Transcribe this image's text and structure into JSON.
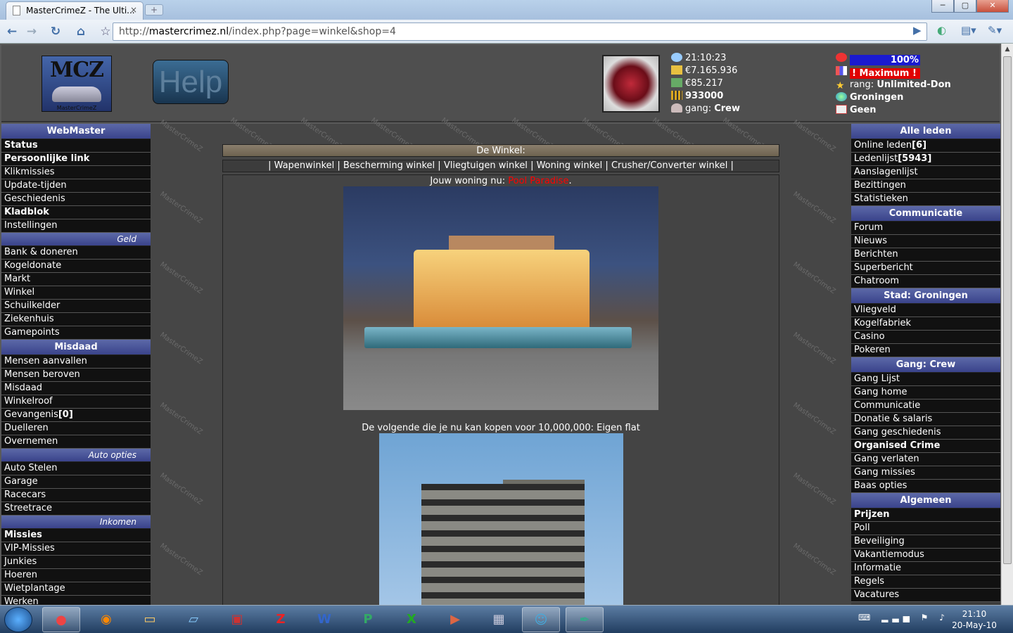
{
  "browser": {
    "tab_title": "MasterCrimeZ - The Ulti...",
    "tab_close": "×",
    "new_tab": "+",
    "url_prefix": "http://",
    "url_domain": "mastercrimez.nl",
    "url_path": "/index.php?page=winkel&shop=4",
    "win_min": "─",
    "win_max": "▢",
    "win_close": "✕"
  },
  "header": {
    "logo_text": "MCZ",
    "logo_sub": "MasterCrimeZ",
    "help_label": "Help",
    "avatar_text": "W",
    "time": "21:10:23",
    "cash": "€7.165.936",
    "bank": "€85.217",
    "bullets": "933000",
    "gang_label": "gang: ",
    "gang_value": "Crew",
    "health": "100%",
    "power": "! Maximum !",
    "rank_label": "rang: ",
    "rank_value": "Unlimited-Don",
    "city": "Groningen",
    "messages": "Geen"
  },
  "left_menu": {
    "webmaster": "WebMaster",
    "status": "Status",
    "persoonlijke": "Persoonlijke link",
    "klikmissies": "Klikmissies",
    "update": "Update-tijden",
    "geschiedenis": "Geschiedenis",
    "kladblok": "Kladblok",
    "instellingen": "Instellingen",
    "geld": "Geld",
    "bank": "Bank & doneren",
    "kogeldonate": "Kogeldonate",
    "markt": "Markt",
    "winkel": "Winkel",
    "schuilkelder": "Schuilkelder",
    "ziekenhuis": "Ziekenhuis",
    "gamepoints": "Gamepoints",
    "misdaad_h": "Misdaad",
    "aanvallen": "Mensen aanvallen",
    "beroven": "Mensen beroven",
    "misdaad": "Misdaad",
    "winkelroof": "Winkelroof",
    "gevangenis": "Gevangenis",
    "gevangenis_count": "[0]",
    "duelleren": "Duelleren",
    "overnemen": "Overnemen",
    "auto_opties": "Auto opties",
    "auto_stelen": "Auto Stelen",
    "garage": "Garage",
    "racecars": "Racecars",
    "streetrace": "Streetrace",
    "inkomen": "Inkomen",
    "missies": "Missies",
    "vip": "VIP-Missies",
    "junkies": "Junkies",
    "hoeren": "Hoeren",
    "wietplantage": "Wietplantage",
    "werken": "Werken"
  },
  "right_menu": {
    "alle_leden": "Alle leden",
    "online": "Online leden",
    "online_count": "[6]",
    "ledenlijst": "Ledenlijst",
    "ledenlijst_count": "[5943]",
    "aanslagenlijst": "Aanslagenlijst",
    "bezittingen": "Bezittingen",
    "statistieken": "Statistieken",
    "communicatie_h": "Communicatie",
    "forum": "Forum",
    "nieuws": "Nieuws",
    "berichten": "Berichten",
    "superbericht": "Superbericht",
    "chatroom": "Chatroom",
    "stad": "Stad: Groningen",
    "vliegveld": "Vliegveld",
    "kogelfabriek": "Kogelfabriek",
    "casino": "Casino",
    "pokeren": "Pokeren",
    "gang_h": "Gang: Crew",
    "gang_lijst": "Gang Lijst",
    "gang_home": "Gang home",
    "communicatie": "Communicatie",
    "donatie": "Donatie & salaris",
    "gang_geschiedenis": "Gang geschiedenis",
    "organised": "Organised Crime",
    "gang_verlaten": "Gang verlaten",
    "gang_missies": "Gang missies",
    "baas": "Baas opties",
    "algemeen": "Algemeen",
    "prijzen": "Prijzen",
    "poll": "Poll",
    "beveiliging": "Beveiliging",
    "vakantie": "Vakantiemodus",
    "informatie": "Informatie",
    "regels": "Regels",
    "vacatures": "Vacatures"
  },
  "main": {
    "title": "De Winkel:",
    "sep": " | ",
    "wapen": "Wapenwinkel",
    "bescherming": "Bescherming winkel",
    "vliegtuigen": "Vliegtuigen winkel",
    "woning": "Woning winkel",
    "crusher": "Crusher/Converter winkel",
    "current_label": "Jouw woning nu: ",
    "current_value": "Pool Paradise",
    "period": ".",
    "next_text": "De volgende die je nu kan kopen voor 10,000,000: Eigen flat"
  },
  "watermark": "MasterCrimeZ",
  "taskbar": {
    "time": "21:10",
    "date": "20-May-10"
  },
  "colors": {
    "menu_header": "#3a438b",
    "health_bar": "#1a1ad0",
    "power_bar": "#e00000",
    "link_red": "#ff0000"
  }
}
